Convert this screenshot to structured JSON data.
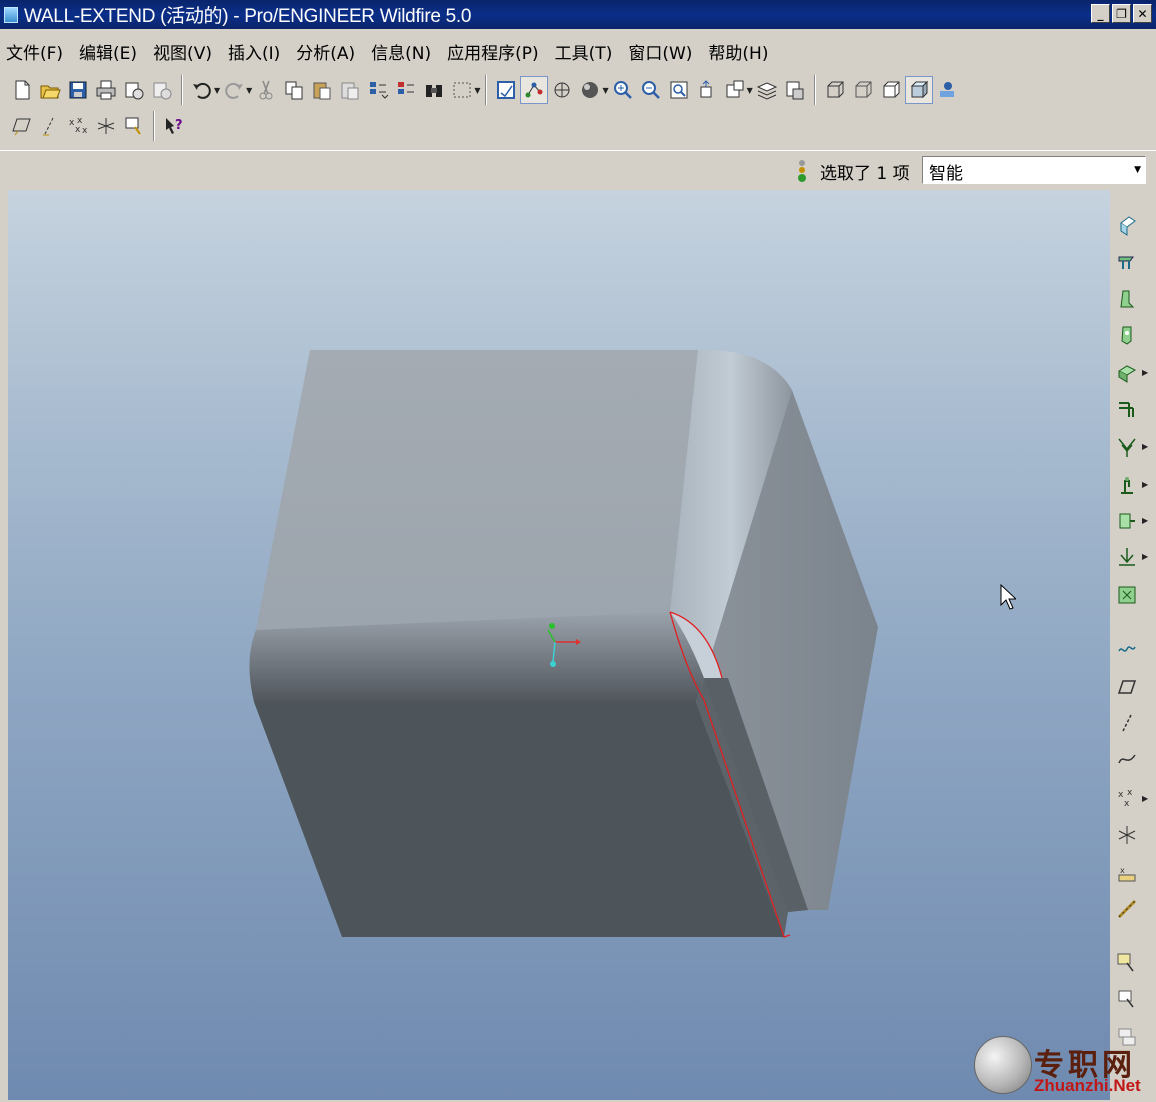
{
  "window": {
    "title": "WALL-EXTEND (活动的) - Pro/ENGINEER Wildfire 5.0",
    "controls": [
      "minimize",
      "restore",
      "close"
    ]
  },
  "menubar": {
    "items": [
      {
        "label": "文件(F)"
      },
      {
        "label": "编辑(E)"
      },
      {
        "label": "视图(V)"
      },
      {
        "label": "插入(I)"
      },
      {
        "label": "分析(A)"
      },
      {
        "label": "信息(N)"
      },
      {
        "label": "应用程序(P)"
      },
      {
        "label": "工具(T)"
      },
      {
        "label": "窗口(W)"
      },
      {
        "label": "帮助(H)"
      }
    ]
  },
  "toolbar": {
    "file_group": [
      "new-icon",
      "open-icon",
      "save-icon",
      "print-icon",
      "email-icon",
      "email-link-icon"
    ],
    "edit_group": [
      "undo-icon",
      "redo-icon",
      "cut-icon",
      "copy-icon",
      "paste-icon",
      "paste-special-icon",
      "regenerate-icon",
      "regen-manager-icon",
      "find-icon",
      "select-box-icon"
    ],
    "view_group": [
      "repaint-icon",
      "spin-center-icon",
      "orient-mode-icon",
      "appearance-icon",
      "zoom-in-icon",
      "zoom-out-icon",
      "refit-icon",
      "reorient-icon",
      "saved-views-icon",
      "layers-icon",
      "view-manager-icon"
    ],
    "display_group": [
      "wireframe-icon",
      "hidden-line-icon",
      "no-hidden-icon",
      "shading-icon",
      "model-tree-icon"
    ],
    "datum_display": [
      "datum-planes-icon",
      "datum-axes-icon",
      "datum-points-icon",
      "coord-sys-icon",
      "annotation-display-icon"
    ],
    "help": "context-help-icon"
  },
  "selection": {
    "status_text": "选取了 1 项",
    "filter_value": "智能"
  },
  "colors": {
    "titlebar": "#0a246a",
    "chrome": "#d4d0c8",
    "viewport_top": "#c6d3df",
    "viewport_bottom": "#6f8ab0",
    "highlight_edge": "#e02020"
  },
  "right_toolbar": [
    "hole-icon",
    "shell-icon",
    "rib-icon",
    "draft-icon",
    "round-icon",
    "chamfer-icon",
    "extrude-icon",
    "revolve-icon",
    "sweep-icon",
    "blend-icon",
    "style-icon",
    "datum-plane-icon",
    "datum-axis-icon",
    "datum-curve-icon",
    "datum-point-icon",
    "csys-icon",
    "analysis-icon",
    "sketch-icon",
    "mirror-icon",
    "merge-icon",
    "trim-icon"
  ],
  "watermark": {
    "cn": "专职网",
    "url": "Zhuanzhi.Net"
  }
}
